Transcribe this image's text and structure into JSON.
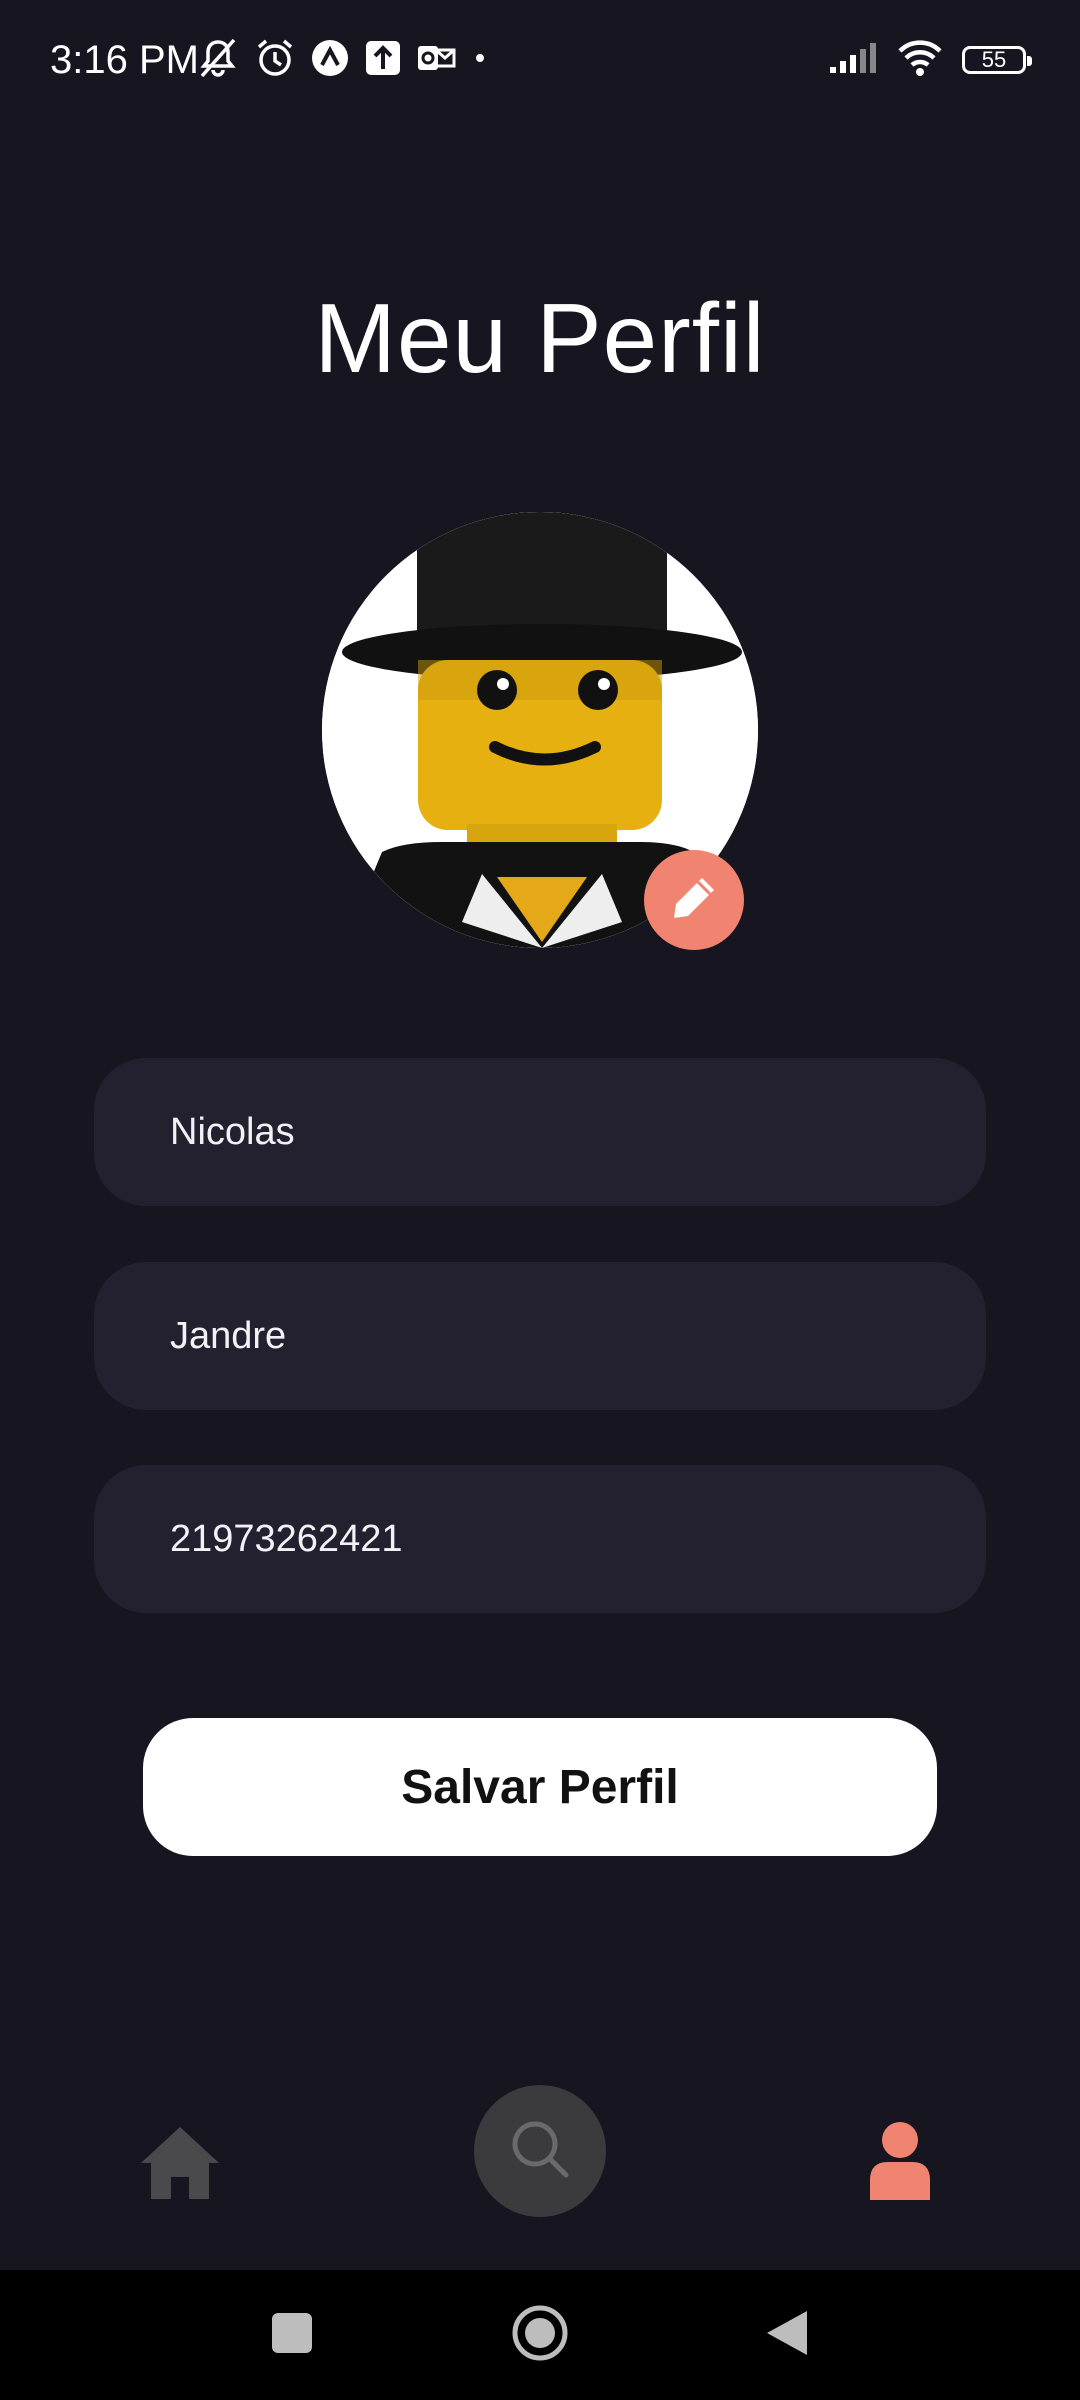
{
  "status_bar": {
    "time": "3:16 PM",
    "battery": "55",
    "icons_left": [
      "mute-icon",
      "alarm-icon",
      "nav-app-icon",
      "upload-icon",
      "outlook-icon",
      "dot-icon"
    ],
    "icons_right": [
      "signal-icon",
      "wifi-icon",
      "battery-icon"
    ]
  },
  "page": {
    "title": "Meu Perfil"
  },
  "profile": {
    "avatar": "lego-minifigure-avatar",
    "edit_icon": "pencil-icon"
  },
  "form": {
    "first_name": "Nicolas",
    "last_name": "Jandre",
    "phone": "21973262421",
    "save_label": "Salvar Perfil"
  },
  "bottom_nav": {
    "items": [
      "home-icon",
      "search-icon",
      "profile-icon"
    ],
    "active": "profile",
    "colors": {
      "inactive": "#4a4a4d",
      "active": "#f08470",
      "search_bg": "#3b3b3d"
    }
  },
  "colors": {
    "background": "#17151f",
    "field_bg": "#23212f",
    "accent": "#f08470",
    "button_bg": "#ffffff"
  }
}
